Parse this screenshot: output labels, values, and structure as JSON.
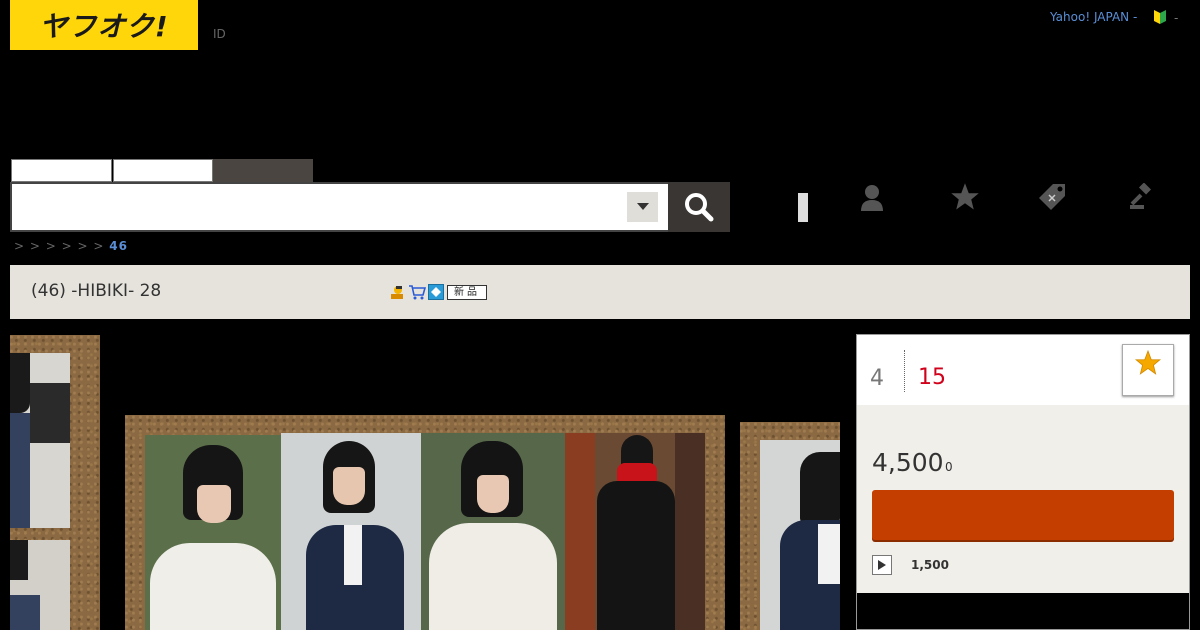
{
  "header": {
    "logo": "ヤフオク!",
    "id_label": "ID",
    "yahoo_link": "Yahoo! JAPAN -",
    "trailing": "-"
  },
  "search": {
    "tabs": [
      "",
      "",
      ""
    ],
    "placeholder": "",
    "value": ""
  },
  "breadcrumb": {
    "prefix": "> >    > > > >",
    "current": "46"
  },
  "item": {
    "title": "(46)  -HIBIKI-  28",
    "new_badge": "新品"
  },
  "panel": {
    "bids": "4",
    "time_left": "15",
    "price": "4,500",
    "price_unit": "0",
    "buy_now_price": "1,500"
  },
  "colors": {
    "brand_yellow": "#ffd60a",
    "bid_button": "#c43e00",
    "time_red": "#d0021b",
    "link_blue": "#5a8ed6"
  },
  "icons": {
    "search": "search-icon",
    "dropdown": "caret-down-icon",
    "user": "user-icon",
    "watch": "star-icon",
    "coupon": "tag-icon",
    "auction": "gavel-icon",
    "play": "play-icon",
    "beginner": "beginner-mark-icon"
  }
}
